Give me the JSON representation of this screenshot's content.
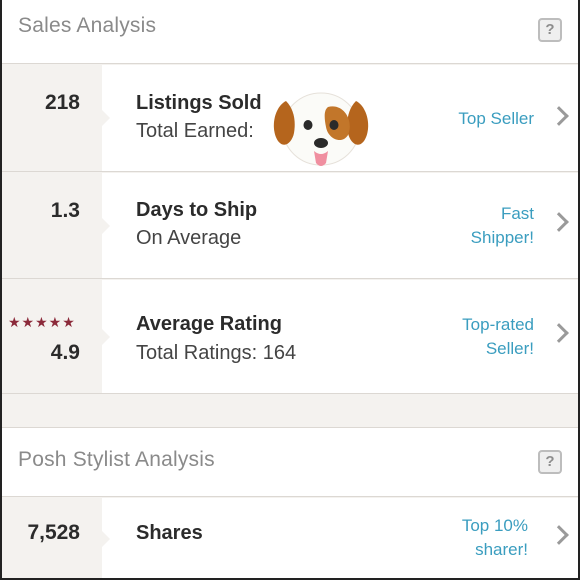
{
  "sales": {
    "title": "Sales Analysis",
    "help": "?",
    "rows": [
      {
        "value": "218",
        "title": "Listings Sold",
        "subtitle": "Total Earned:",
        "badge_lines": [
          "Top Seller"
        ]
      },
      {
        "value": "1.3",
        "title": "Days to Ship",
        "subtitle": "On Average",
        "badge_lines": [
          "Fast",
          "Shipper!"
        ]
      },
      {
        "value": "4.9",
        "stars": "★★★★★",
        "title": "Average Rating",
        "subtitle": "Total Ratings: 164",
        "badge_lines": [
          "Top-rated",
          "Seller!"
        ]
      }
    ]
  },
  "stylist": {
    "title": "Posh Stylist Analysis",
    "help": "?",
    "rows": [
      {
        "value": "7,528",
        "title": "Shares",
        "badge_lines": [
          "Top 10%",
          "sharer!"
        ]
      }
    ]
  },
  "icons": {
    "sticker": "dog-face-emoji-icon",
    "row_arrow": "chevron-right-icon",
    "help": "help-icon"
  },
  "colors": {
    "link": "#3a9dbf",
    "stars": "#8b2a3a",
    "stat_bg": "#f4f2ef"
  }
}
